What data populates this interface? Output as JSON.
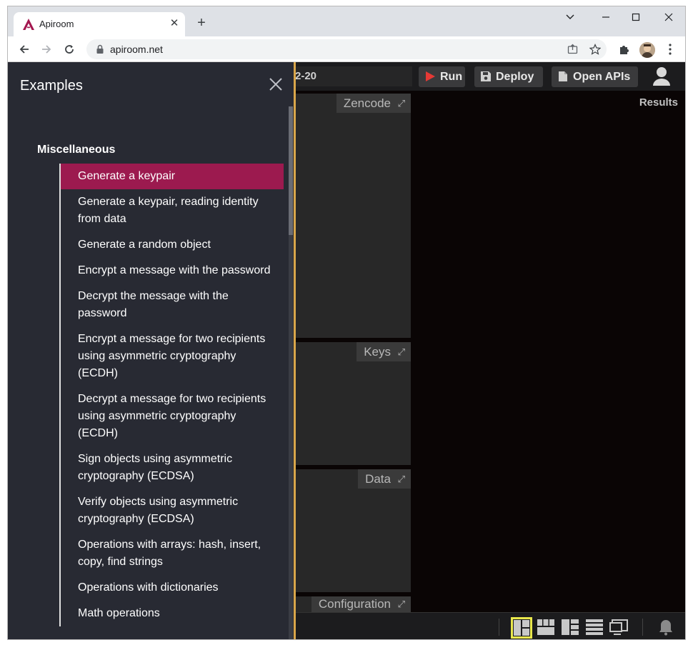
{
  "browser": {
    "tab_title": "Apiroom",
    "tab_close": "✕",
    "new_tab": "+",
    "url": "apiroom.net",
    "window_minimize": "—",
    "window_maximize": "☐",
    "window_close": "✕"
  },
  "app": {
    "revision_text": "2-20",
    "run_label": "Run",
    "deploy_label": "Deploy",
    "open_apis_label": "Open APIs",
    "panels": {
      "zencode": "Zencode",
      "keys": "Keys",
      "data": "Data",
      "configuration": "Configuration"
    },
    "results_label": "Results"
  },
  "drawer": {
    "title": "Examples",
    "section": "Miscellaneous",
    "items": [
      "Generate a keypair",
      "Generate a keypair, reading identity from data",
      "Generate a random object",
      "Encrypt a message with the password",
      "Decrypt the message with the password",
      "Encrypt a message for two recipients using asymmetric cryptography (ECDH)",
      "Decrypt a message for two recipients using asymmetric cryptography (ECDH)",
      "Sign objects using asymmetric cryptography (ECDSA)",
      "Verify objects using asymmetric cryptography (ECDSA)",
      "Operations with arrays: hash, insert, copy, find strings",
      "Operations with dictionaries",
      "Math operations"
    ],
    "active_index": 0
  },
  "colors": {
    "accent": "#9c1a4f",
    "drawer_bg": "#282a33",
    "drawer_edge": "#d9a64a",
    "layout_selected": "#e9e74c",
    "run_icon": "#e53935"
  }
}
